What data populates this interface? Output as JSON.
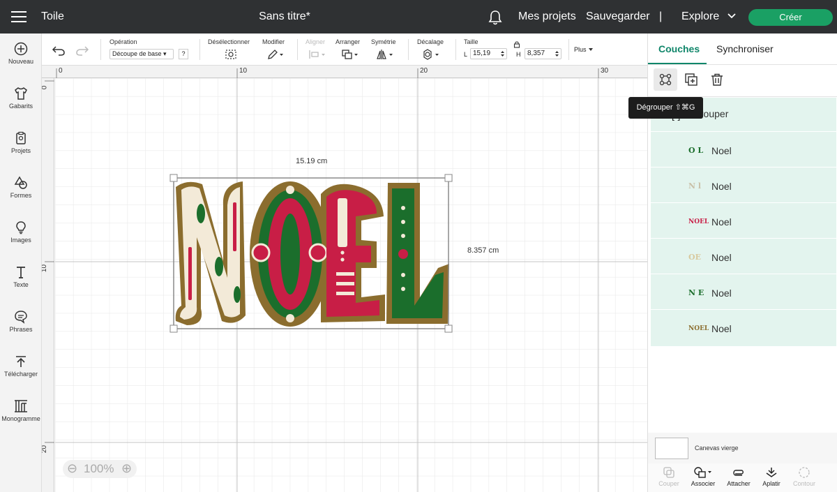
{
  "topbar": {
    "app_title": "Toile",
    "doc_title": "Sans titre*",
    "my_projects": "Mes projets",
    "save": "Sauvegarder",
    "divider": "|",
    "explore": "Explore",
    "create": "Créer"
  },
  "leftrail": {
    "items": [
      {
        "label": "Nouveau",
        "icon": "plus-circle-icon"
      },
      {
        "label": "Gabarits",
        "icon": "shirt-icon"
      },
      {
        "label": "Projets",
        "icon": "clipboard-icon"
      },
      {
        "label": "Formes",
        "icon": "shapes-icon"
      },
      {
        "label": "Images",
        "icon": "lightbulb-icon"
      },
      {
        "label": "Texte",
        "icon": "text-icon"
      },
      {
        "label": "Phrases",
        "icon": "speech-bubble-icon"
      },
      {
        "label": "Télécharger",
        "icon": "upload-icon"
      },
      {
        "label": "Monogramme",
        "icon": "monogram-icon"
      }
    ]
  },
  "toolbar": {
    "operation_label": "Opération",
    "operation_value": "Découpe de base ▾",
    "help": "?",
    "deselect": "Désélectionner",
    "modify": "Modifier",
    "align": "Aligner",
    "arrange": "Arranger",
    "symmetry": "Symétrie",
    "offset": "Décalage",
    "size_label": "Taille",
    "width_label": "L",
    "width_value": "15,19",
    "height_label": "H",
    "height_value": "8,357",
    "more": "Plus"
  },
  "canvas": {
    "ruler_top": [
      "0",
      "10",
      "20",
      "30"
    ],
    "ruler_left": [
      "0",
      "10",
      "20"
    ],
    "width_dim": "15.19 cm",
    "height_dim": "8.357 cm",
    "zoom": "100%",
    "artwork_text": "NOEL"
  },
  "colors": {
    "accent": "#10866a",
    "create": "#1aa064",
    "gold": "#8b6d2e",
    "red": "#c81e46",
    "green": "#1b6e2c",
    "cream": "#f3ead8"
  },
  "panel": {
    "tab_layers": "Couches",
    "tab_sync": "Synchroniser",
    "tooltip": "Dégrouper ⇧⌘G",
    "group_label": "Grouper",
    "layers": [
      {
        "thumb": "O L",
        "name": "Noel",
        "color": "#1b6e2c"
      },
      {
        "thumb": "N l",
        "name": "Noel",
        "color": "#c9c0a8"
      },
      {
        "thumb": "NOEL",
        "name": "Noel",
        "color": "#c81e46"
      },
      {
        "thumb": "OE",
        "name": "Noel",
        "color": "#e3d7b5"
      },
      {
        "thumb": "N E",
        "name": "Noel",
        "color": "#1b6e2c"
      },
      {
        "thumb": "NOEL",
        "name": "Noel",
        "color": "#8b6d2e"
      }
    ],
    "blank_canvas": "Canevas vierge",
    "actions": [
      {
        "label": "Couper",
        "disabled": true
      },
      {
        "label": "Associer",
        "disabled": false
      },
      {
        "label": "Attacher",
        "disabled": false
      },
      {
        "label": "Aplatir",
        "disabled": false
      },
      {
        "label": "Contour",
        "disabled": true
      }
    ]
  }
}
